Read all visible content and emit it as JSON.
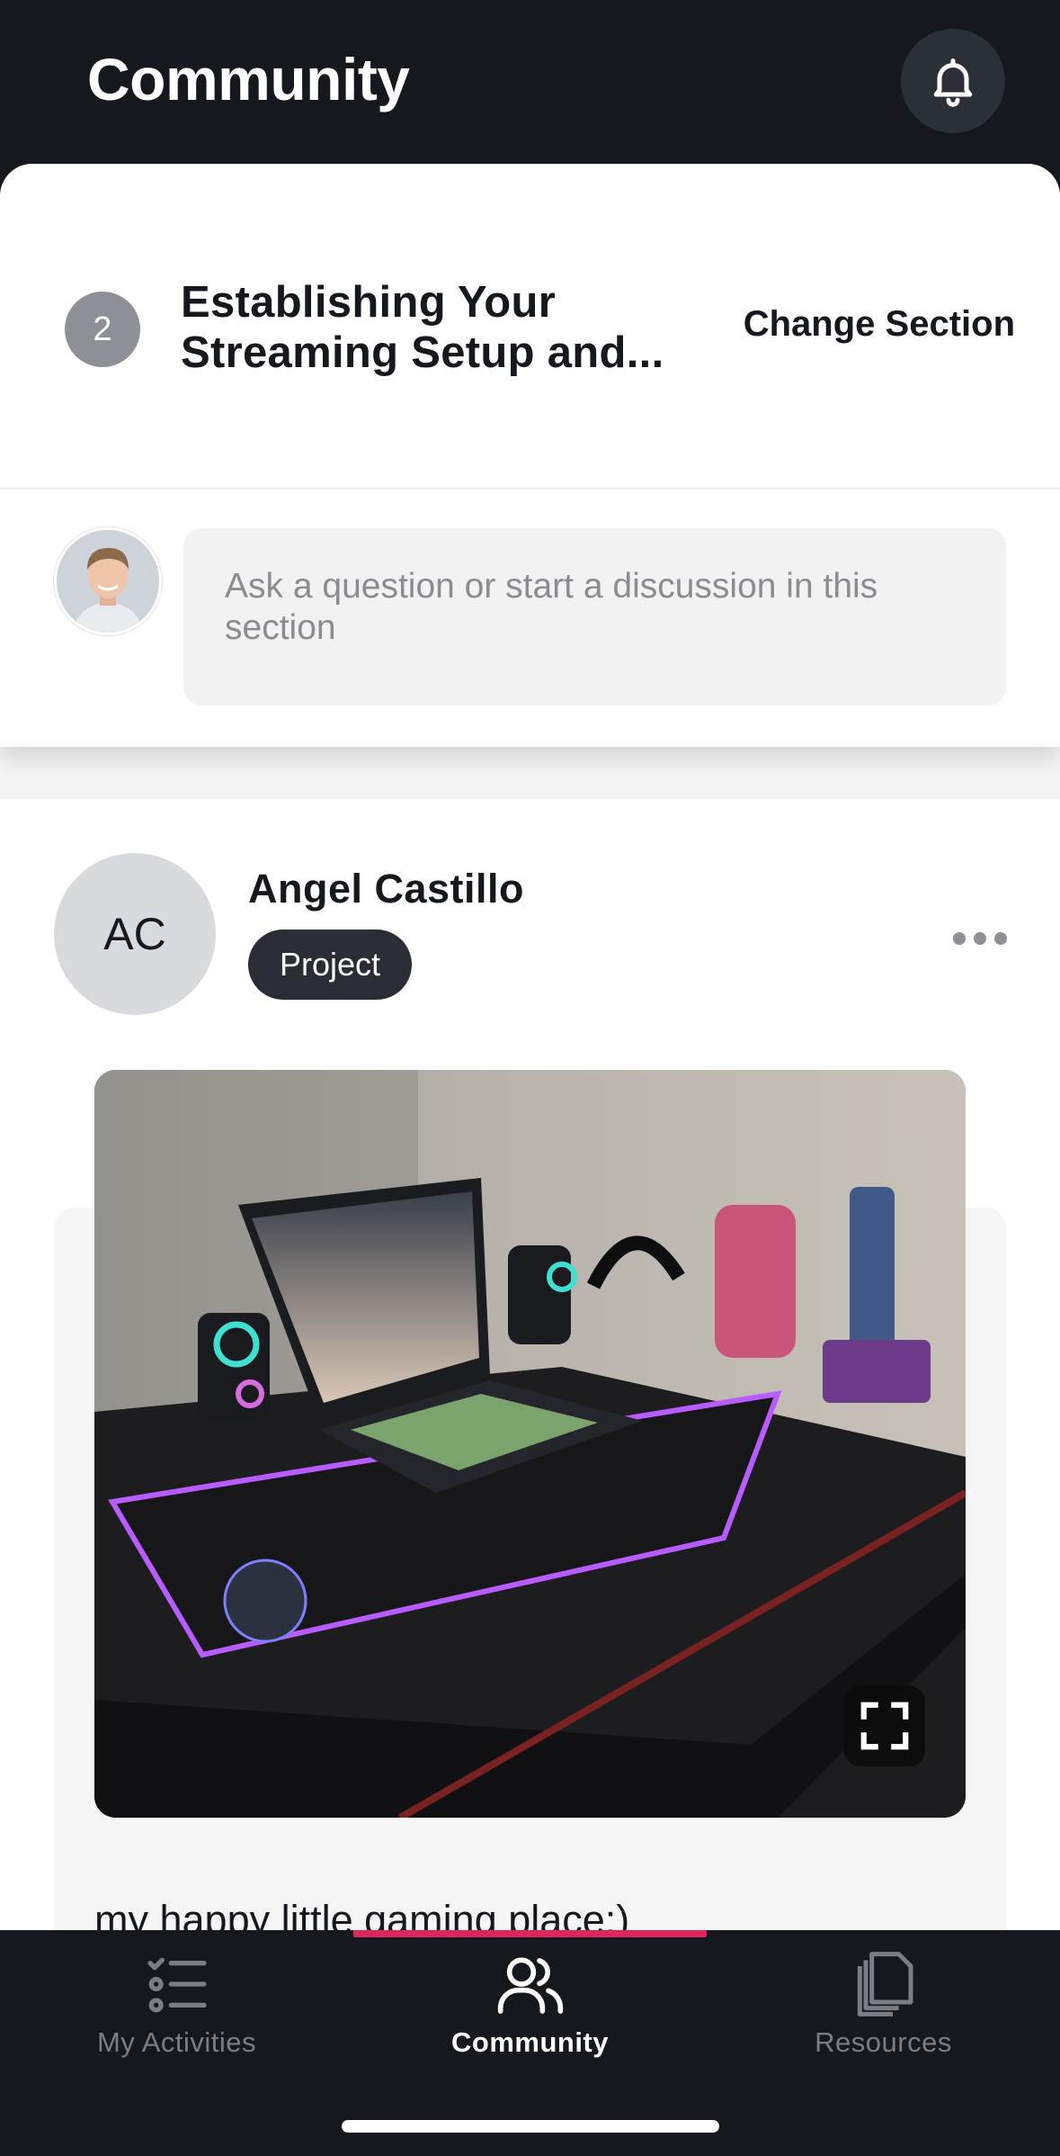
{
  "header": {
    "title": "Community"
  },
  "section": {
    "number": "2",
    "title": "Establishing Your Streaming Setup and...",
    "change_label": "Change Section"
  },
  "composer": {
    "placeholder": "Ask a question or start a discussion in this section"
  },
  "post": {
    "initials": "AC",
    "author": "Angel Castillo",
    "tag": "Project",
    "caption": "my happy little gaming place:)"
  },
  "tabs": [
    {
      "label": "My Activities",
      "icon": "list-icon",
      "active": false
    },
    {
      "label": "Community",
      "icon": "people-icon",
      "active": true
    },
    {
      "label": "Resources",
      "icon": "documents-icon",
      "active": false
    }
  ],
  "colors": {
    "accent": "#e0245e",
    "dark": "#15181d",
    "tag_bg": "#2a2d36"
  }
}
